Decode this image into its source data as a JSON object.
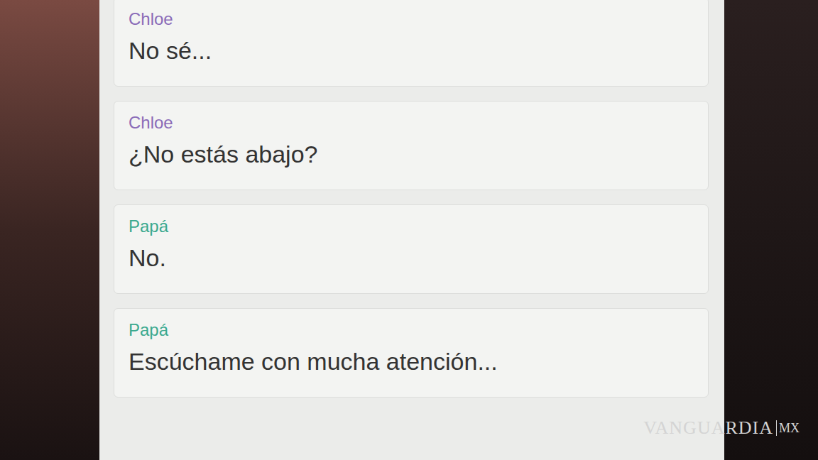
{
  "messages": [
    {
      "sender": "Chloe",
      "text": "No sé...",
      "color": "#8a6bb8"
    },
    {
      "sender": "Chloe",
      "text": "¿No estás abajo?",
      "color": "#8a6bb8"
    },
    {
      "sender": "Papá",
      "text": "No.",
      "color": "#3aa98f"
    },
    {
      "sender": "Papá",
      "text": "Escúchame con mucha atención...",
      "color": "#3aa98f"
    }
  ],
  "watermark": {
    "brand": "VANGUARDIA",
    "region": "MX"
  }
}
